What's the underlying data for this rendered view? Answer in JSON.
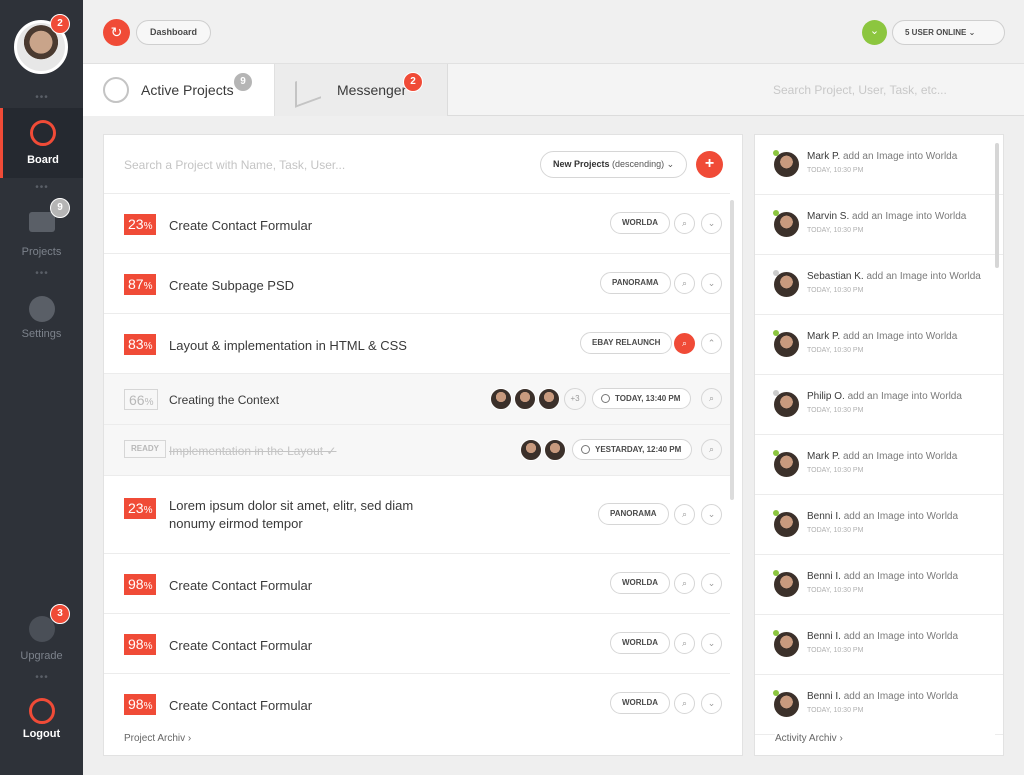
{
  "sidebar": {
    "avatar_badge": "2",
    "items": [
      {
        "label": "Board"
      },
      {
        "label": "Projects",
        "badge": "9"
      },
      {
        "label": "Settings"
      },
      {
        "label": "Upgrade",
        "badge": "3"
      },
      {
        "label": "Logout"
      }
    ]
  },
  "topbar": {
    "breadcrumb": "Dashboard",
    "online": "5 USER ONLINE"
  },
  "tabs": {
    "active": {
      "label": "Active Projects",
      "badge": "9"
    },
    "messenger": {
      "label": "Messenger",
      "badge": "2"
    },
    "search_placeholder": "Search Project, User, Task, etc..."
  },
  "projects": {
    "search_placeholder": "Search a Project with Name, Task, User...",
    "sort_strong": "New Projects",
    "sort_rest": "(descending)",
    "rows": [
      {
        "pct": "23",
        "title": "Create Contact Formular",
        "tag": "WORLDA"
      },
      {
        "pct": "87",
        "title": "Create Subpage PSD",
        "tag": "PANORAMA"
      },
      {
        "pct": "83",
        "title": "Layout & implementation in HTML & CSS",
        "tag": "EBAY RELAUNCH"
      },
      {
        "pct": "66",
        "title": "Creating the Context",
        "more": "+3",
        "time": "TODAY, 13:40 PM"
      },
      {
        "pct": "READY",
        "title": "Implementation in the Layout ✓",
        "time": "YESTARDAY, 12:40 PM"
      },
      {
        "pct": "23",
        "title": "Lorem ipsum dolor sit amet, elitr, sed diam nonumy eirmod tempor",
        "tag": "PANORAMA"
      },
      {
        "pct": "98",
        "title": "Create Contact Formular",
        "tag": "WORLDA"
      },
      {
        "pct": "98",
        "title": "Create Contact Formular",
        "tag": "WORLDA"
      },
      {
        "pct": "98",
        "title": "Create Contact Formular",
        "tag": "WORLDA"
      }
    ],
    "archiv": "Project Archiv  ›"
  },
  "activity": {
    "items": [
      {
        "name": "Mark P.",
        "text": "add an Image into Worlda",
        "when": "TODAY, 10:30 PM",
        "online": true
      },
      {
        "name": "Marvin S.",
        "text": "add an Image into Worlda",
        "when": "TODAY, 10:30 PM",
        "online": true
      },
      {
        "name": "Sebastian K.",
        "text": "add an Image into Worlda",
        "when": "TODAY, 10:30 PM",
        "online": false
      },
      {
        "name": "Mark P.",
        "text": "add an Image into Worlda",
        "when": "TODAY, 10:30 PM",
        "online": true
      },
      {
        "name": "Philip O.",
        "text": "add an Image into Worlda",
        "when": "TODAY, 10:30 PM",
        "online": false
      },
      {
        "name": "Mark P.",
        "text": "add an Image into Worlda",
        "when": "TODAY, 10:30 PM",
        "online": true
      },
      {
        "name": "Benni I.",
        "text": "add an Image into Worlda",
        "when": "TODAY, 10:30 PM",
        "online": true
      },
      {
        "name": "Benni I.",
        "text": "add an Image into Worlda",
        "when": "TODAY, 10:30 PM",
        "online": true
      },
      {
        "name": "Benni I.",
        "text": "add an Image into Worlda",
        "when": "TODAY, 10:30 PM",
        "online": true
      },
      {
        "name": "Benni I.",
        "text": "add an Image into Worlda",
        "when": "TODAY, 10:30 PM",
        "online": true
      }
    ],
    "archiv": "Activity Archiv  ›"
  },
  "colors": {
    "accent": "#f04b37",
    "online": "#8cc63f",
    "sidebar": "#2e3239"
  }
}
